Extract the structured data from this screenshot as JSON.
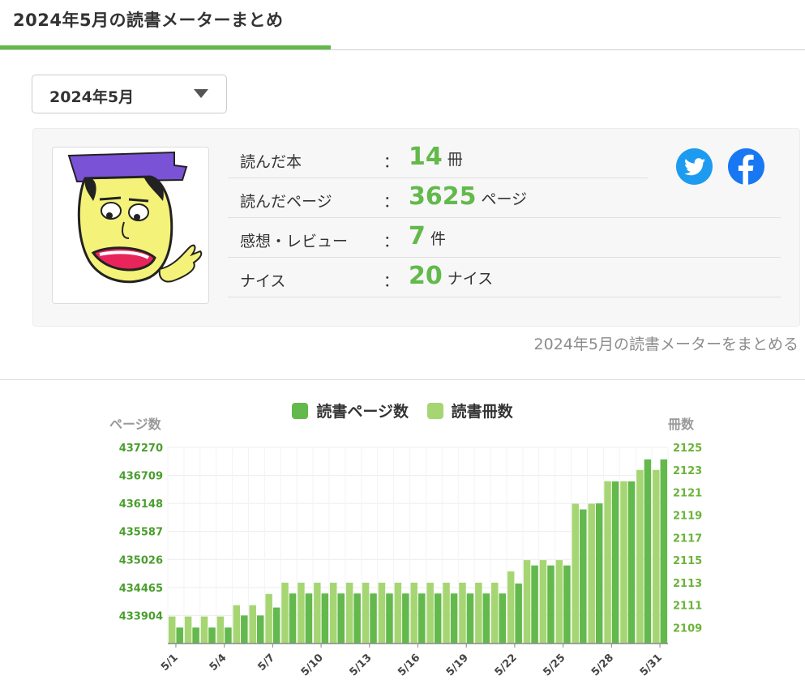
{
  "header": {
    "title": "2024年5月の読書メーターまとめ"
  },
  "month_select": {
    "value": "2024年5月"
  },
  "stats": [
    {
      "label": "読んだ本",
      "value": "14",
      "unit": "冊"
    },
    {
      "label": "読んだページ",
      "value": "3625",
      "unit": "ページ"
    },
    {
      "label": "感想・レビュー",
      "value": "7",
      "unit": "件"
    },
    {
      "label": "ナイス",
      "value": "20",
      "unit": "ナイス"
    }
  ],
  "stat_colon": "：",
  "summary_link": "2024年5月の読書メーターをまとめる",
  "colors": {
    "accent": "#63b94b",
    "accent_light": "#a6d673",
    "twitter": "#1d9bf0",
    "facebook": "#1877f2"
  },
  "icons": {
    "twitter": "twitter-icon",
    "facebook": "facebook-icon",
    "dropdown": "caret-down-icon"
  },
  "chart_data": {
    "type": "bar",
    "legend": [
      "読書ページ数",
      "読書冊数"
    ],
    "left_axis_title": "ページ数",
    "right_axis_title": "冊数",
    "left_ticks": [
      433904,
      434465,
      435026,
      435587,
      436148,
      436709,
      437270
    ],
    "right_ticks": [
      2109,
      2111,
      2113,
      2115,
      2117,
      2119,
      2121,
      2123,
      2125
    ],
    "left_range": [
      433343,
      437270
    ],
    "right_range": [
      2107.6,
      2125
    ],
    "x_tick_labels": [
      "5/1",
      "5/4",
      "5/7",
      "5/10",
      "5/13",
      "5/16",
      "5/19",
      "5/22",
      "5/25",
      "5/28",
      "5/31"
    ],
    "x_tick_every": 3,
    "categories": [
      "5/1",
      "5/2",
      "5/3",
      "5/4",
      "5/5",
      "5/6",
      "5/7",
      "5/8",
      "5/9",
      "5/10",
      "5/11",
      "5/12",
      "5/13",
      "5/14",
      "5/15",
      "5/16",
      "5/17",
      "5/18",
      "5/19",
      "5/20",
      "5/21",
      "5/22",
      "5/23",
      "5/24",
      "5/25",
      "5/26",
      "5/27",
      "5/28",
      "5/29",
      "5/30",
      "5/31"
    ],
    "series": [
      {
        "name": "読書ページ数",
        "axis": "left",
        "values": [
          433663,
          433663,
          433663,
          433663,
          433904,
          433904,
          434064,
          434345,
          434345,
          434345,
          434345,
          434345,
          434345,
          434345,
          434345,
          434345,
          434345,
          434345,
          434345,
          434345,
          434345,
          434545,
          434906,
          434906,
          434906,
          436028,
          436148,
          436589,
          436589,
          437030,
          437030
        ]
      },
      {
        "name": "読書冊数",
        "axis": "right",
        "values": [
          2110,
          2110,
          2110,
          2110,
          2111,
          2111,
          2112,
          2113,
          2113,
          2113,
          2113,
          2113,
          2113,
          2113,
          2113,
          2113,
          2113,
          2113,
          2113,
          2113,
          2113,
          2114,
          2115,
          2115,
          2115,
          2120,
          2120,
          2122,
          2122,
          2123,
          2123
        ]
      }
    ]
  }
}
